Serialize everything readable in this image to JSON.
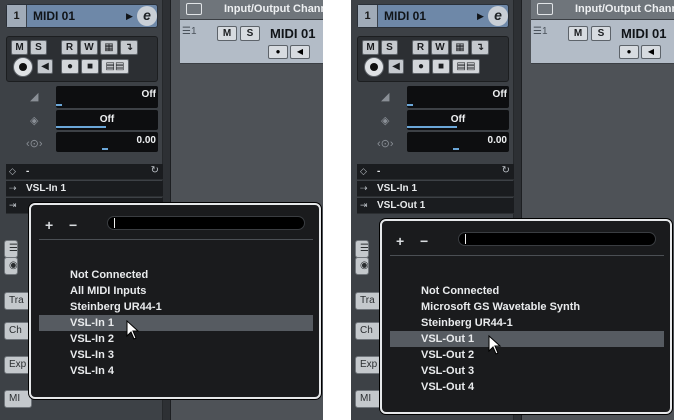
{
  "panels": [
    {
      "track": {
        "number": "1",
        "name": "MIDI 01"
      },
      "buttons": {
        "m": "M",
        "s": "S",
        "r": "R",
        "w": "W"
      },
      "fader_values": {
        "volume": "Off",
        "pan": "Off",
        "delay": "0.00"
      },
      "rows": {
        "program": "-",
        "input": "VSL-In 1"
      },
      "side_tabs": [
        "Tra",
        "Ch",
        "Exp",
        "MI"
      ],
      "channel": {
        "title": "Input/Output Chann",
        "list_num": "1",
        "name": "MIDI 01",
        "m": "M",
        "s": "S"
      },
      "popup": {
        "plus": "+",
        "minus": "−",
        "items": [
          "Not Connected",
          "All MIDI Inputs",
          "Steinberg UR44-1",
          "VSL-In 1",
          "VSL-In 2",
          "VSL-In 3",
          "VSL-In 4"
        ],
        "selected_index": 3
      }
    },
    {
      "track": {
        "number": "1",
        "name": "MIDI 01"
      },
      "buttons": {
        "m": "M",
        "s": "S",
        "r": "R",
        "w": "W"
      },
      "fader_values": {
        "volume": "Off",
        "pan": "Off",
        "delay": "0.00"
      },
      "rows": {
        "program": "-",
        "input": "VSL-In 1",
        "output": "VSL-Out 1"
      },
      "side_tabs": [
        "Tra",
        "Ch",
        "Exp",
        "MI"
      ],
      "channel": {
        "title": "Input/Output Chann",
        "list_num": "1",
        "name": "MIDI 01",
        "m": "M",
        "s": "S"
      },
      "popup": {
        "plus": "+",
        "minus": "−",
        "items": [
          "Not Connected",
          "Microsoft GS Wavetable Synth",
          "Steinberg UR44-1",
          "VSL-Out 1",
          "VSL-Out 2",
          "VSL-Out 3",
          "VSL-Out 4"
        ],
        "selected_index": 3
      }
    }
  ],
  "colors": {
    "track_header": "#6e88a8",
    "channel_body": "#b3bcc7",
    "popup_bg": "#1a1b1d",
    "popup_border": "#e6e8ea",
    "selection": "#565b61",
    "fader_bar": "#6aa6d8"
  }
}
